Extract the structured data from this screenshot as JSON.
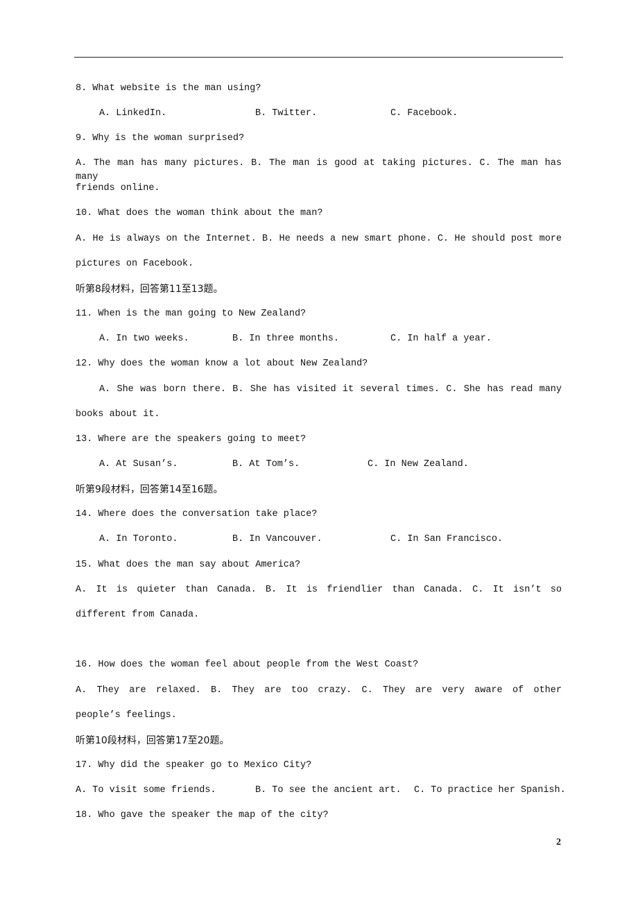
{
  "page_number": "2",
  "lines": [
    {
      "text": "8. What website is the man using?"
    },
    {
      "options": [
        "A. LinkedIn.",
        "B. Twitter.",
        "C. Facebook."
      ]
    },
    {
      "text": "9. Why is the woman surprised?"
    },
    {
      "text": "A. The man has many pictures.  B. The man is good at taking pictures. C. The man has many",
      "justify": true
    },
    {
      "text": "friends online."
    },
    {
      "text": "10. What does the woman think about the man?"
    },
    {
      "text": "A. He is always on the Internet. B. He needs a new smart phone.   C. He should post more",
      "justify": true
    },
    {
      "text": "pictures on Facebook."
    },
    {
      "text": "听第8段材料，回答第11至13题。",
      "cn": true
    },
    {
      "text": "11. When is the man going to New Zealand?"
    },
    {
      "options": [
        "A. In two weeks.",
        "B. In three months.",
        "C. In half a year."
      ]
    },
    {
      "text": "12. Why does the woman know a lot about New Zealand?"
    },
    {
      "text": "A. She was born there.    B. She has visited it several times.   C. She has read many",
      "justify": true,
      "indent": true
    },
    {
      "text": "books about it."
    },
    {
      "text": "13. Where are the speakers going to meet?"
    },
    {
      "options": [
        "A. At Susan’s.",
        "B. At Tom’s.",
        "C. In New Zealand."
      ]
    },
    {
      "text": "听第9段材料，回答第14至16题。",
      "cn": true
    },
    {
      "text": "14. Where does the conversation take place?"
    },
    {
      "options": [
        "A. In Toronto.",
        "B. In Vancouver.",
        "C. In San Francisco."
      ]
    },
    {
      "text": "15. What does the man say about America?"
    },
    {
      "text": "A. It is quieter than Canada.  B. It is friendlier than Canada.  C. It isn’t so",
      "justify": true
    },
    {
      "text": "different from Canada."
    },
    {
      "text": "16. How does the woman feel about people from the West Coast?"
    },
    {
      "text": "A. They are relaxed.   B. They are too crazy.  C. They are very aware of other",
      "justify": true
    },
    {
      "text": "people’s feelings."
    },
    {
      "text": "听第10段材料，回答第17至20题。",
      "cn": true
    },
    {
      "text": "17. Why did the speaker go to Mexico City?"
    },
    {
      "options": [
        "A. To visit some friends.",
        "B. To see the ancient art.",
        "C. To practice her Spanish."
      ]
    },
    {
      "text": "18. Who gave the speaker the map of the city?"
    }
  ]
}
